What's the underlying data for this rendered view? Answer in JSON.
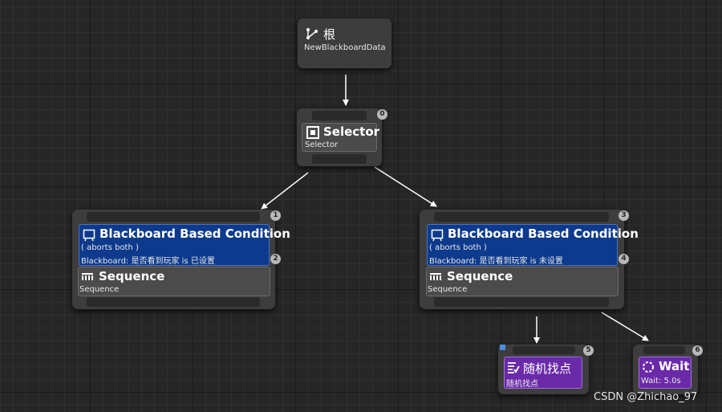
{
  "root": {
    "title": "根",
    "subtitle": "NewBlackboardData"
  },
  "selector": {
    "title": "Selector",
    "subtitle": "Selector",
    "index": "0"
  },
  "left_branch": {
    "decorator": {
      "title": "Blackboard Based Condition",
      "aborts": "( aborts both )",
      "key_line": "Blackboard: 是否看到玩家 is 已设置",
      "index": "1"
    },
    "sequence": {
      "title": "Sequence",
      "subtitle": "Sequence",
      "index": "2"
    }
  },
  "right_branch": {
    "decorator": {
      "title": "Blackboard Based Condition",
      "aborts": "( aborts both )",
      "key_line": "Blackboard: 是否看到玩家 is 未设置",
      "index": "3"
    },
    "sequence": {
      "title": "Sequence",
      "subtitle": "Sequence",
      "index": "4"
    }
  },
  "task_random": {
    "title": "随机找点",
    "subtitle": "随机找点",
    "index": "5"
  },
  "task_wait": {
    "title": "Wait",
    "subtitle": "Wait: 5.0s",
    "index": "6"
  },
  "watermark": "CSDN @Zhichao_97",
  "colors": {
    "decorator": "#0d3a8c",
    "task": "#6a2aa8",
    "node": "#3d3d3d",
    "wire": "#ffffff"
  }
}
